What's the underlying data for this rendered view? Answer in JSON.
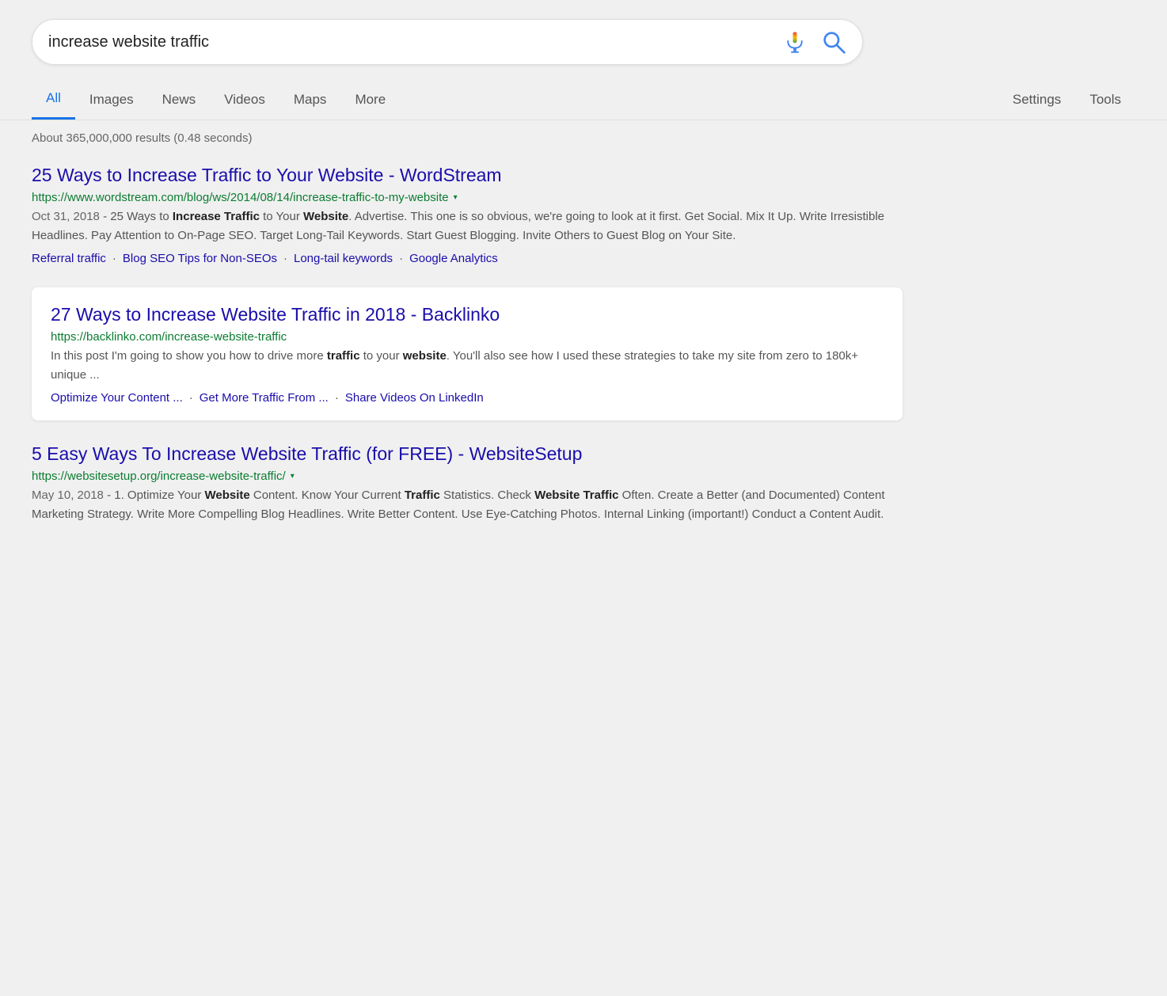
{
  "search": {
    "query": "increase website traffic",
    "mic_label": "voice search",
    "search_label": "search"
  },
  "tabs": {
    "items": [
      {
        "id": "all",
        "label": "All",
        "active": true
      },
      {
        "id": "images",
        "label": "Images",
        "active": false
      },
      {
        "id": "news",
        "label": "News",
        "active": false
      },
      {
        "id": "videos",
        "label": "Videos",
        "active": false
      },
      {
        "id": "maps",
        "label": "Maps",
        "active": false
      },
      {
        "id": "more",
        "label": "More",
        "active": false
      }
    ],
    "right": [
      {
        "id": "settings",
        "label": "Settings"
      },
      {
        "id": "tools",
        "label": "Tools"
      }
    ]
  },
  "result_count": "About 365,000,000 results (0.48 seconds)",
  "results": [
    {
      "id": "wordstream",
      "title": "25 Ways to Increase Traffic to Your Website - WordStream",
      "url": "https://www.wordstream.com/blog/ws/2014/08/14/increase-traffic-to-my-website",
      "has_dropdown": true,
      "highlighted": false,
      "snippet_date": "Oct 31, 2018",
      "snippet_parts": [
        {
          "text": " - 25 Ways to ",
          "bold": false
        },
        {
          "text": "Increase Traffic",
          "bold": true
        },
        {
          "text": " to Your ",
          "bold": false
        },
        {
          "text": "Website",
          "bold": true
        },
        {
          "text": ". Advertise. This one is so obvious, we're going to look at it first. Get Social. Mix It Up. Write Irresistible Headlines. Pay Attention to On-Page SEO. Target Long-Tail Keywords. Start Guest Blogging. Invite Others to Guest Blog on Your Site.",
          "bold": false
        }
      ],
      "links": [
        {
          "text": "Referral traffic",
          "sep": true
        },
        {
          "text": "Blog SEO Tips for Non-SEOs",
          "sep": true
        },
        {
          "text": "Long-tail keywords",
          "sep": true
        },
        {
          "text": "Google Analytics",
          "sep": false
        }
      ]
    },
    {
      "id": "backlinko",
      "title": "27 Ways to Increase Website Traffic in 2018 - Backlinko",
      "url": "https://backlinko.com/increase-website-traffic",
      "has_dropdown": false,
      "highlighted": true,
      "snippet_date": "",
      "snippet_parts": [
        {
          "text": "In this post I'm going to show you how to drive more ",
          "bold": false
        },
        {
          "text": "traffic",
          "bold": true
        },
        {
          "text": " to your ",
          "bold": false
        },
        {
          "text": "website",
          "bold": true
        },
        {
          "text": ". You'll also see how I used these strategies to take my site from zero to 180k+ unique ...",
          "bold": false
        }
      ],
      "links": [
        {
          "text": "Optimize Your Content ...",
          "sep": true
        },
        {
          "text": "Get More Traffic From ...",
          "sep": true
        },
        {
          "text": "Share Videos On LinkedIn",
          "sep": false
        }
      ]
    },
    {
      "id": "websitesetup",
      "title": "5 Easy Ways To Increase Website Traffic (for FREE) - WebsiteSetup",
      "url": "https://websitesetup.org/increase-website-traffic/",
      "has_dropdown": true,
      "highlighted": false,
      "snippet_date": "May 10, 2018",
      "snippet_parts": [
        {
          "text": " - 1. Optimize Your ",
          "bold": false
        },
        {
          "text": "Website",
          "bold": true
        },
        {
          "text": " Content. Know Your Current ",
          "bold": false
        },
        {
          "text": "Traffic",
          "bold": true
        },
        {
          "text": " Statistics. Check ",
          "bold": false
        },
        {
          "text": "Website Traffic",
          "bold": true
        },
        {
          "text": " Often. Create a Better (and Documented) Content Marketing Strategy. Write More Compelling Blog Headlines. Write Better Content. Use Eye-Catching Photos. Internal Linking (important!) Conduct a Content Audit.",
          "bold": false
        }
      ],
      "links": []
    }
  ]
}
